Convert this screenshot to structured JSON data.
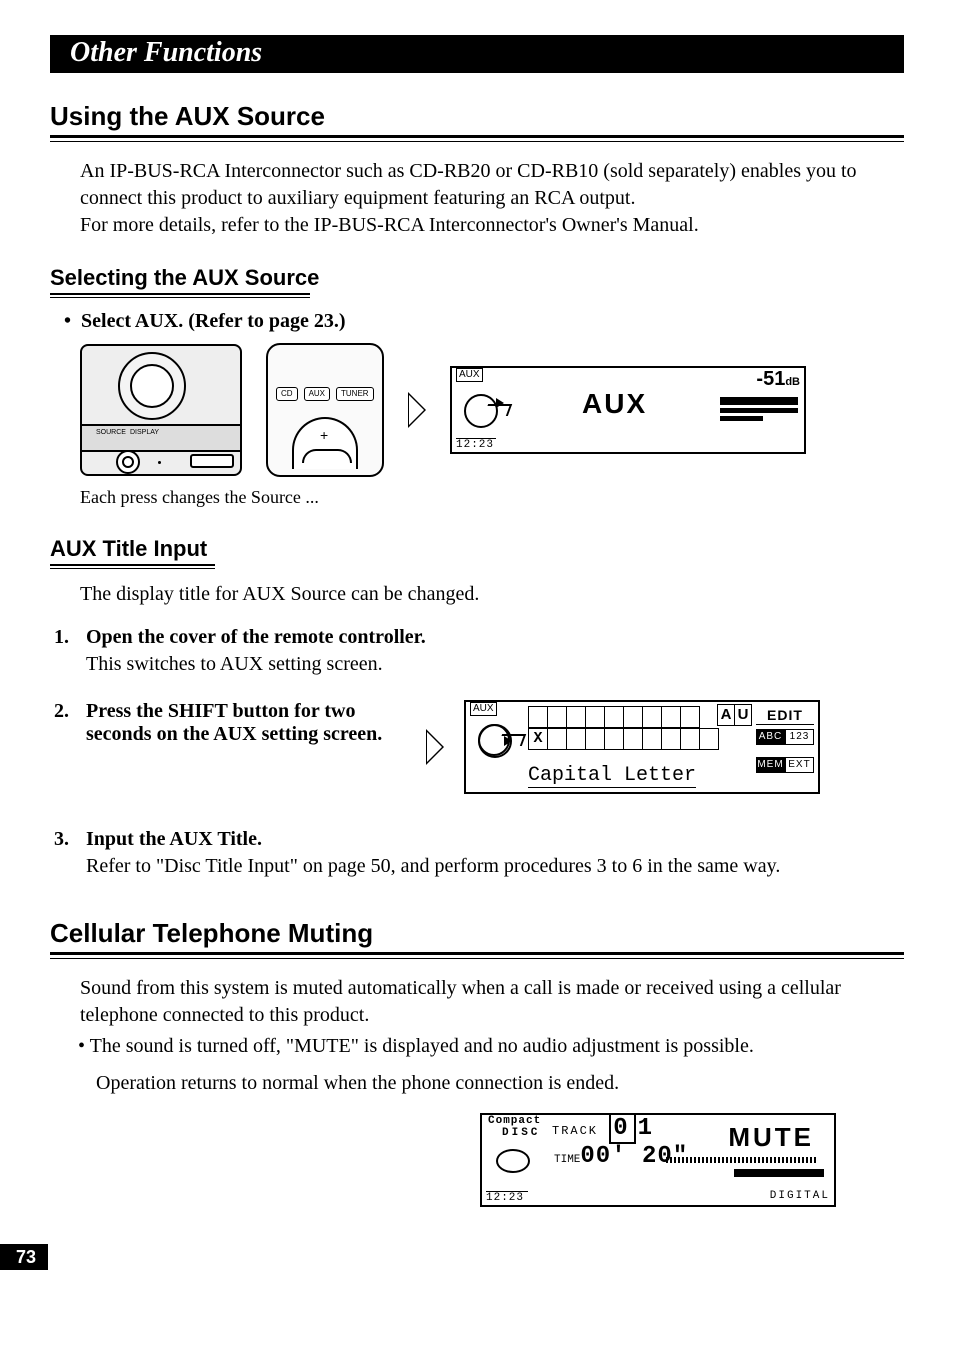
{
  "chapter_title": "Other Functions",
  "sec1": {
    "title": "Using the AUX Source",
    "intro": "An IP-BUS-RCA Interconnector such as CD-RB20 or CD-RB10 (sold separately) enables you to connect this product to auxiliary equipment featuring an RCA output.\nFor more details, refer to the IP-BUS-RCA Interconnector's Owner's Manual."
  },
  "sec1a": {
    "title": "Selecting the AUX Source",
    "bullet": "Select AUX. (Refer to page 23.)",
    "device_labels": {
      "source": "SOURCE",
      "display": "DISPLAY"
    },
    "remote_buttons": [
      "CD",
      "AUX",
      "TUNER"
    ],
    "caption": "Each press changes the Source ...",
    "lcd": {
      "top_left": "AUX",
      "clock": "12:23",
      "center": "AUX",
      "db_value": "-51",
      "db_unit": "dB"
    }
  },
  "sec1b": {
    "title": "AUX Title Input",
    "intro": "The display title for AUX Source can be changed.",
    "steps": {
      "s1_num": "1.",
      "s1_title": "Open the cover of the remote controller.",
      "s1_body": "This switches to AUX setting screen.",
      "s2_num": "2.",
      "s2_title": "Press the SHIFT button for two seconds on the AUX setting screen.",
      "s3_num": "3.",
      "s3_title": "Input the AUX Title.",
      "s3_body": "Refer to \"Disc Title Input\" on page 50, and perform procedures 3 to 6 in the same way."
    },
    "lcd": {
      "top_left": "AUX",
      "letter": "X",
      "subtitle": "Capital Letter",
      "au_a": "A",
      "au_u": "U",
      "right_header": "EDIT",
      "abc": "ABC",
      "n123": "123",
      "mem": "MEM",
      "ext": "EXT"
    }
  },
  "sec2": {
    "title": "Cellular Telephone Muting",
    "intro": "Sound from this system is muted automatically when a call is made or received using a cellular telephone connected to this product.",
    "bullet": "The sound is turned off, \"MUTE\" is displayed and no audio adjustment is possible.",
    "bullet_line2": "Operation returns to normal when the phone connection is ended.",
    "lcd": {
      "cd1": "Compact",
      "cd2": "DISC",
      "track_label": "TRACK",
      "track_box": "0",
      "track_num": "1",
      "time_label": "TIME",
      "time_value": "00' 20\"",
      "clock": "12:23",
      "mute": "MUTE",
      "digital": "DIGITAL"
    }
  },
  "page_number": "73"
}
